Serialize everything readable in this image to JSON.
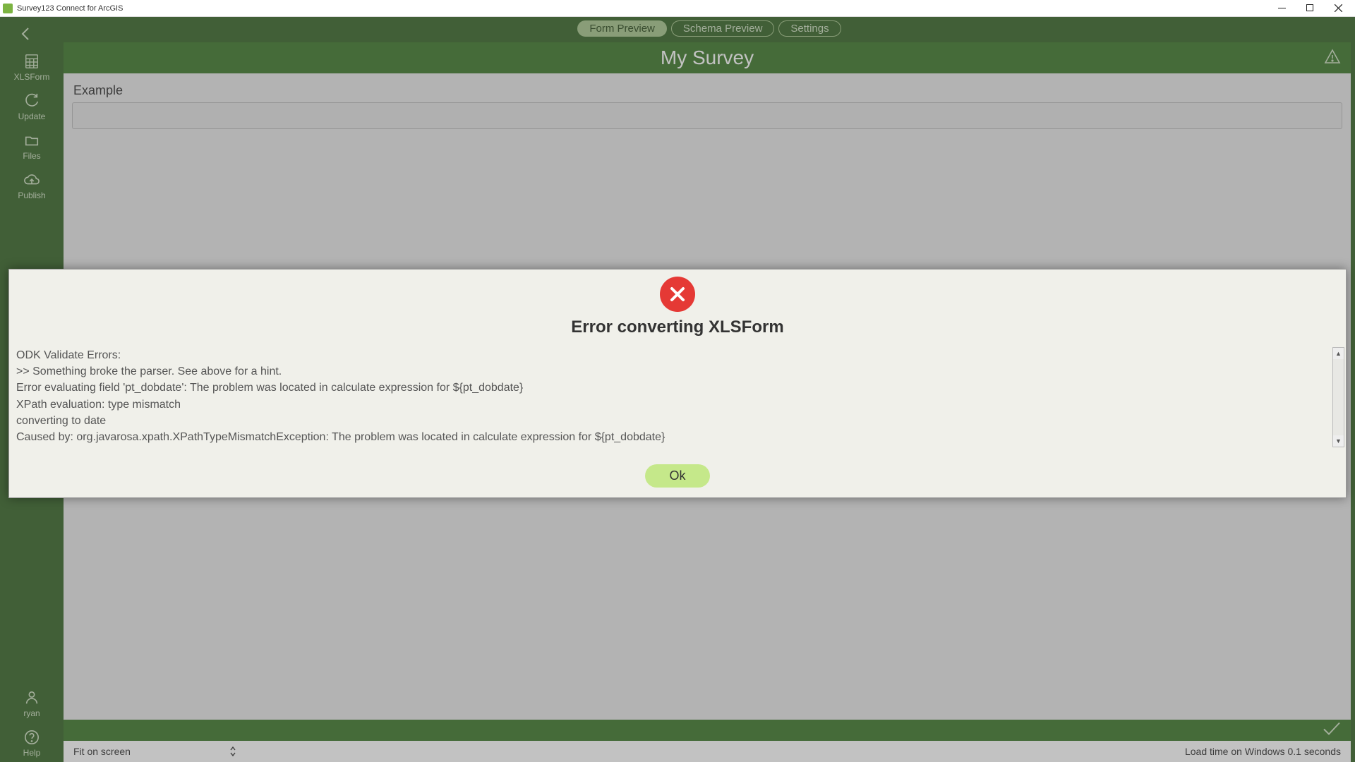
{
  "window": {
    "title": "Survey123 Connect for ArcGIS"
  },
  "sidebar": {
    "items": [
      {
        "label": "XLSForm"
      },
      {
        "label": "Update"
      },
      {
        "label": "Files"
      },
      {
        "label": "Publish"
      }
    ],
    "user": "ryan",
    "help": "Help"
  },
  "tabs": {
    "form_preview": "Form Preview",
    "schema_preview": "Schema Preview",
    "settings": "Settings"
  },
  "survey": {
    "title": "My Survey",
    "field_label": "Example"
  },
  "statusbar": {
    "zoom": "Fit on screen",
    "load_time": "Load time on Windows 0.1 seconds"
  },
  "modal": {
    "title": "Error converting XLSForm",
    "body": "ODK Validate Errors:\n>> Something broke the parser. See above for a hint.\nError evaluating field 'pt_dobdate': The problem was located in calculate expression for ${pt_dobdate}\nXPath evaluation: type mismatch\nconverting to date\nCaused by: org.javarosa.xpath.XPathTypeMismatchException: The problem was located in calculate expression for ${pt_dobdate}\nXPath evaluation: type mismatch",
    "ok": "Ok"
  }
}
